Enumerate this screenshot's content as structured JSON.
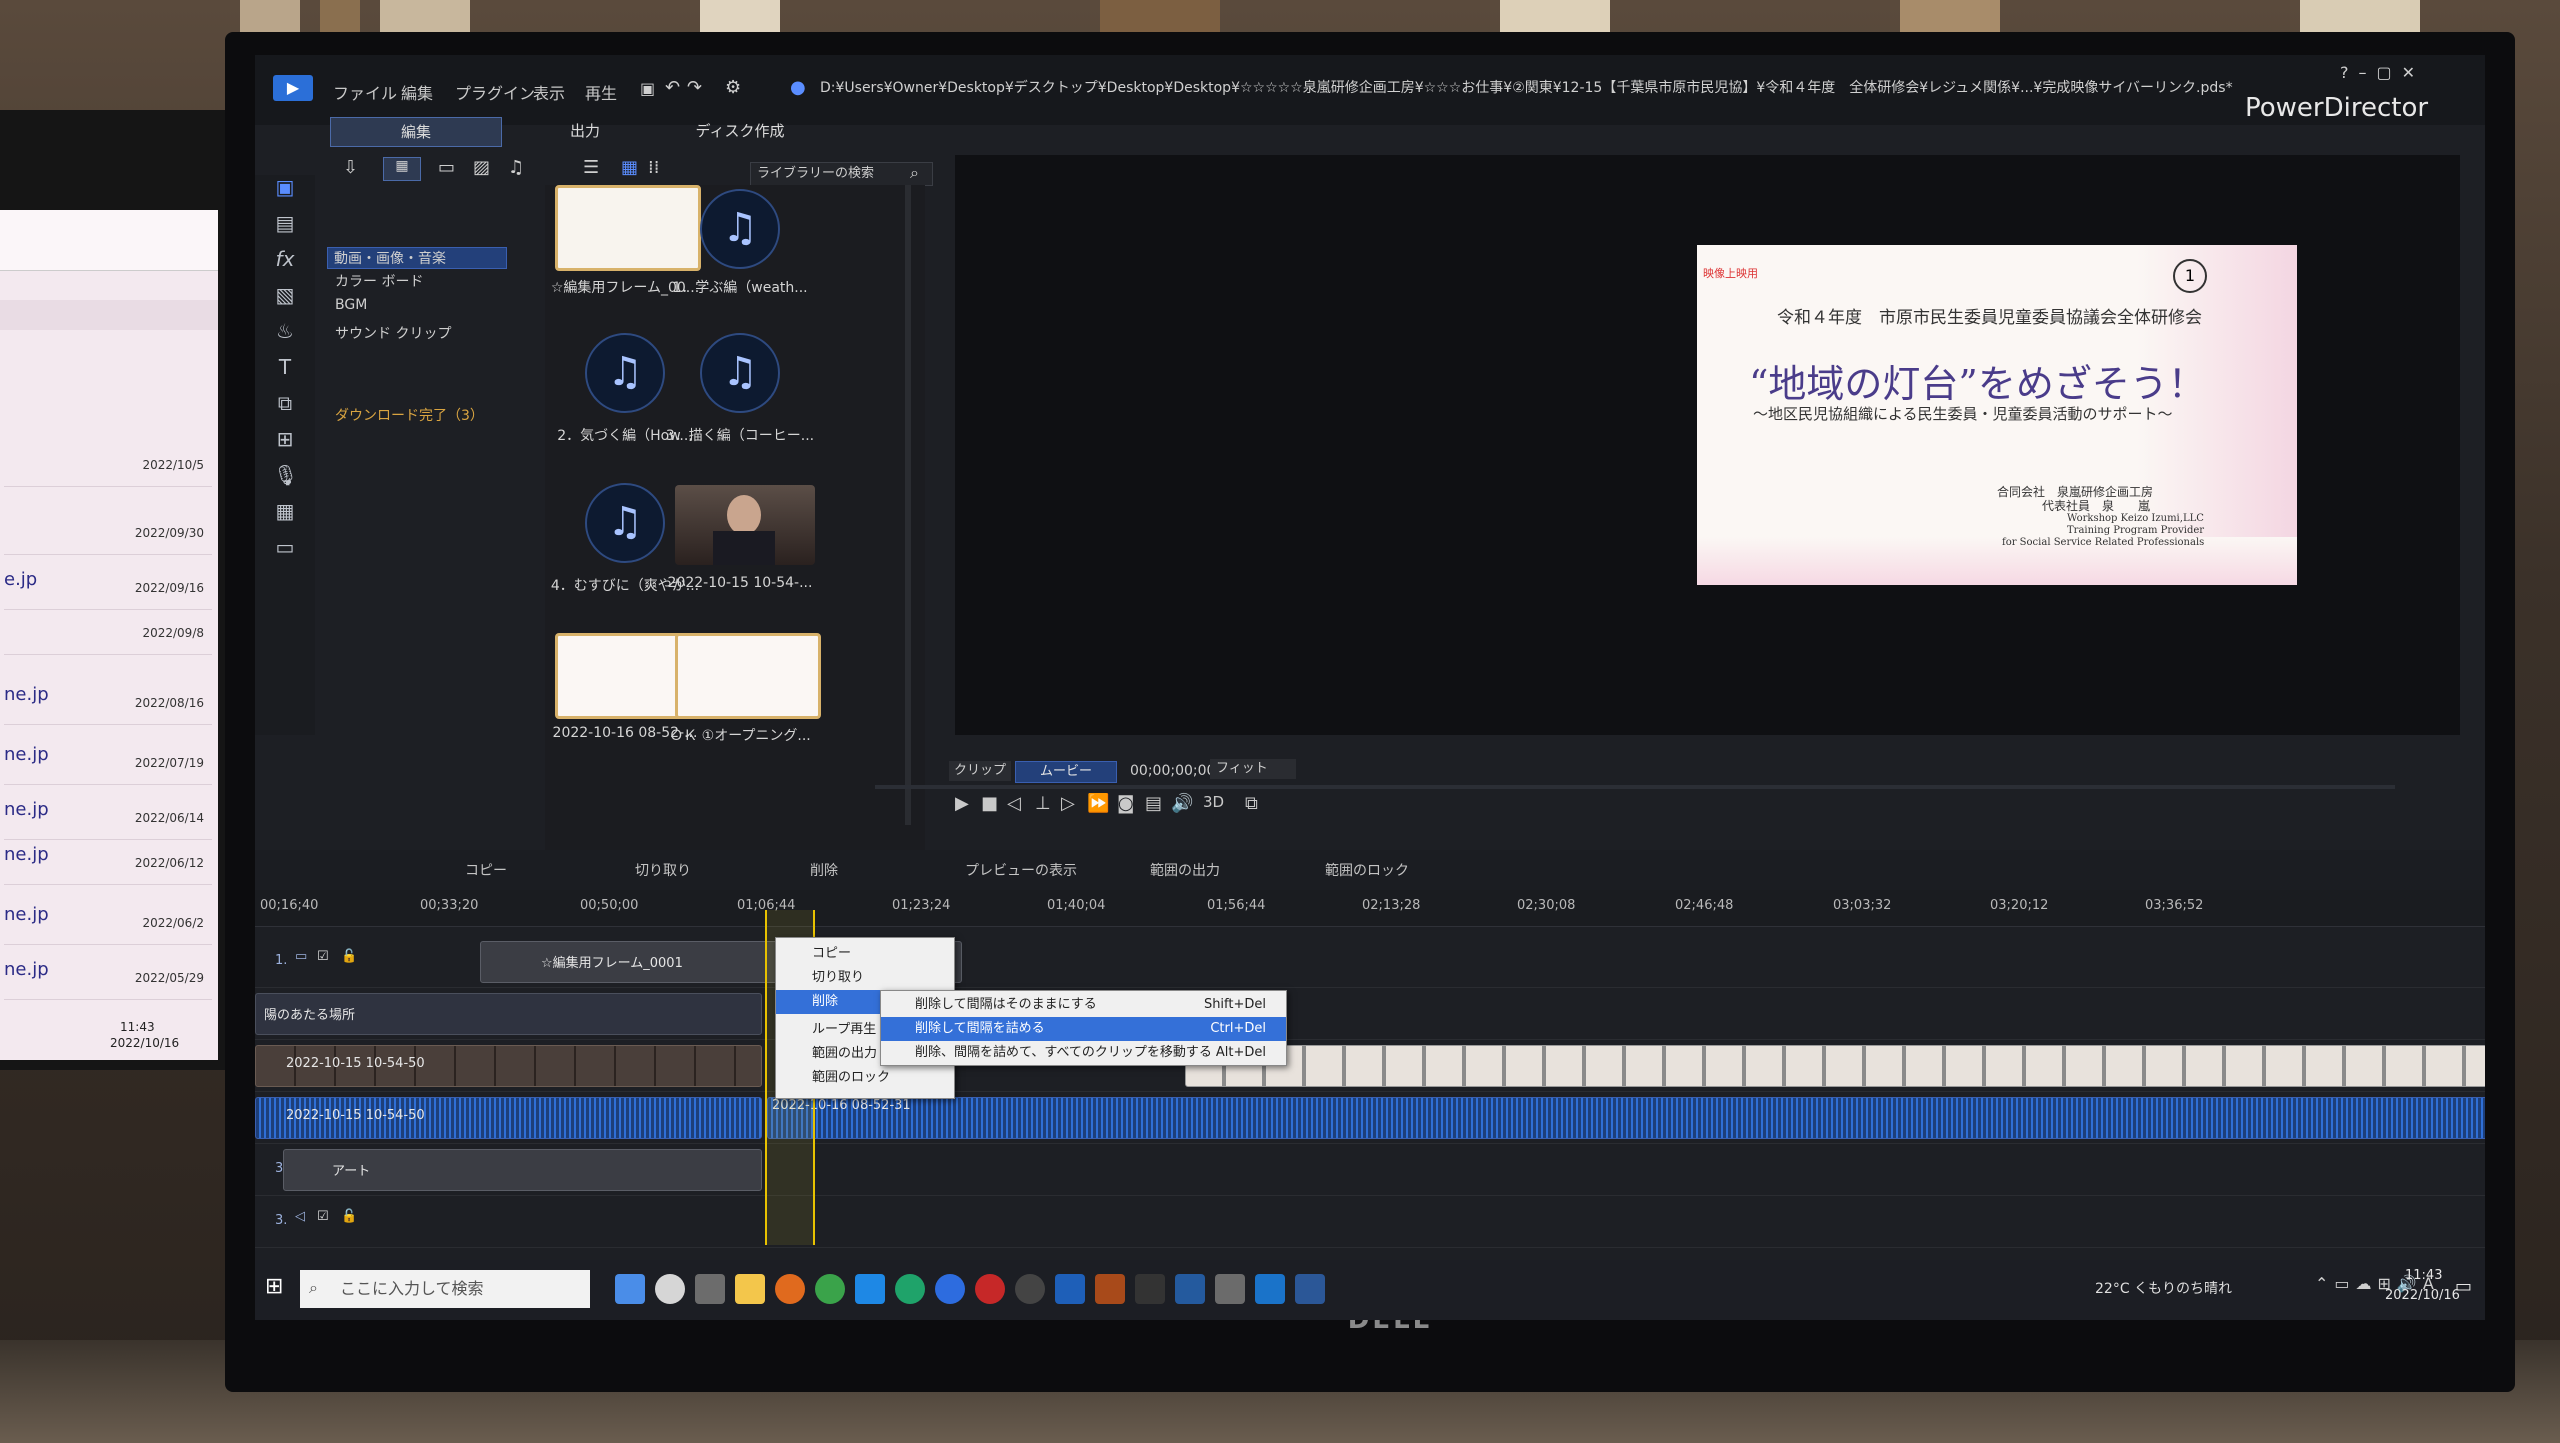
{
  "app": {
    "menu": [
      "ファイル",
      "編集",
      "プラグイン",
      "表示",
      "再生"
    ],
    "path": "D:¥Users¥Owner¥Desktop¥デスクトップ¥Desktop¥Desktop¥☆☆☆☆☆泉嵐研修企画工房¥☆☆☆お仕事¥②関東¥12-15【千葉県市原市民児協】¥令和４年度　全体研修会¥レジュメ関係¥...¥完成映像サイバーリンク.pds*",
    "brand": "PowerDirector",
    "tabs": [
      "編集",
      "出力",
      "ディスク作成"
    ]
  },
  "library": {
    "search_placeholder": "ライブラリーの検索",
    "categories": [
      "動画・画像・音楽",
      "カラー ボード",
      "BGM",
      "サウンド クリップ"
    ],
    "download_status": "ダウンロード完了（3）",
    "items": [
      {
        "caption": "☆編集用フレーム_00...",
        "kind": "frame"
      },
      {
        "caption": "1．学ぶ編（weath...",
        "kind": "music"
      },
      {
        "caption": "2．気づく編（How...",
        "kind": "music"
      },
      {
        "caption": "3．描く編（コーヒー...",
        "kind": "music"
      },
      {
        "caption": "4．むすびに（爽やか...",
        "kind": "music"
      },
      {
        "caption": "2022-10-15 10-54-...",
        "kind": "video"
      },
      {
        "caption": "2022-10-16 08-52-...",
        "kind": "slide"
      },
      {
        "caption": "ＯＫ ①オープニング...",
        "kind": "slide"
      }
    ]
  },
  "preview": {
    "slide_tag": "映像上映用",
    "slide_number": "1",
    "line1": "令和４年度　市原市民生委員児童委員協議会全体研修会",
    "title": "“地域の灯台”をめざそう！",
    "subtitle": "～地区民児協組織による民生委員・児童委員活動のサポート～",
    "org1": "合同会社　泉嵐研修企画工房",
    "org2": "代表社員　泉　　嵐",
    "org3": "Workshop Keizo Izumi,LLC",
    "org4": "Training Program Provider",
    "org5": "for Social Service Related Professionals"
  },
  "transport": {
    "clip_label": "クリップ",
    "movie_label": "ムービー",
    "timecode": "00;00;00;00",
    "fit": "フィット",
    "mode": "3D"
  },
  "timeline": {
    "toolbar": [
      "コピー",
      "切り取り",
      "削除",
      "プレビューの表示",
      "範囲の出力",
      "範囲のロック"
    ],
    "ticks": [
      "00;16;40",
      "00;33;20",
      "00;50;00",
      "01;06;44",
      "01;23;24",
      "01;40;04",
      "01;56;44",
      "02;13;28",
      "02;30;08",
      "02;46;48",
      "03;03;32",
      "03;20;12",
      "03;36;52"
    ],
    "tracks": [
      {
        "label": "1.",
        "clip": "☆編集用フレーム_0001"
      },
      {
        "label": "1.",
        "clip": "陽のあたる場所"
      },
      {
        "label": "2.",
        "clip": "2022-10-15 10-54-50"
      },
      {
        "label": "2.",
        "clip": "2022-10-15 10-54-50"
      },
      {
        "label": "3.",
        "clip": "アート"
      },
      {
        "label": "3.",
        "clip": ""
      }
    ],
    "right_clip_label": "2022-10-16 08-52-31"
  },
  "context_menu": {
    "items": [
      "コピー",
      "切り取り",
      "削除",
      "ループ再生",
      "範囲の出力",
      "範囲のロック"
    ],
    "submenu": [
      {
        "label": "削除して間隔はそのままにする",
        "shortcut": "Shift+Del"
      },
      {
        "label": "削除して間隔を詰める",
        "shortcut": "Ctrl+Del"
      },
      {
        "label": "削除、間隔を詰めて、すべてのクリップを移動する",
        "shortcut": "Alt+Del"
      }
    ]
  },
  "taskbar": {
    "search_placeholder": "ここに入力して検索",
    "weather": "22°C  くもりのち晴れ",
    "time": "11:43",
    "date": "2022/10/16"
  },
  "left_monitor": {
    "rows": [
      {
        "left": "",
        "right": "2022/10/5"
      },
      {
        "left": "",
        "right": "2022/09/30"
      },
      {
        "left": "e.jp",
        "right": "2022/09/16"
      },
      {
        "left": "",
        "right": "2022/09/8"
      },
      {
        "left": "ne.jp",
        "right": "2022/08/16"
      },
      {
        "left": "ne.jp",
        "right": "2022/07/19"
      },
      {
        "left": "ne.jp",
        "right": "2022/06/14"
      },
      {
        "left": "ne.jp",
        "right": "2022/06/12"
      },
      {
        "left": "ne.jp",
        "right": "2022/06/2"
      },
      {
        "left": "ne.jp",
        "right": "2022/05/29"
      }
    ],
    "time": "11:43",
    "date": "2022/10/16"
  },
  "colors": {
    "accent": "#2f6fd6",
    "selection": "#3470d8",
    "playhead": "#e8c200"
  }
}
